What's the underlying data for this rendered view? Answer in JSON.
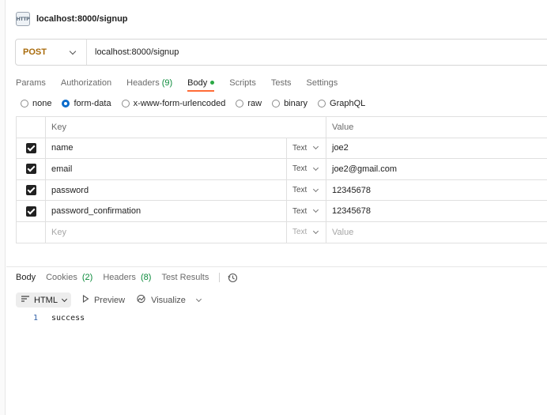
{
  "request": {
    "title": "localhost:8000/signup",
    "method": "POST",
    "url": "localhost:8000/signup"
  },
  "tabs": [
    {
      "label": "Params"
    },
    {
      "label": "Authorization"
    },
    {
      "label": "Headers",
      "count": "(9)"
    },
    {
      "label": "Body"
    },
    {
      "label": "Scripts"
    },
    {
      "label": "Tests"
    },
    {
      "label": "Settings"
    }
  ],
  "body_types": [
    {
      "label": "none"
    },
    {
      "label": "form-data"
    },
    {
      "label": "x-www-form-urlencoded"
    },
    {
      "label": "raw"
    },
    {
      "label": "binary"
    },
    {
      "label": "GraphQL"
    }
  ],
  "table": {
    "header_key": "Key",
    "header_value": "Value",
    "rows": [
      {
        "key": "name",
        "type": "Text",
        "value": "joe2"
      },
      {
        "key": "email",
        "type": "Text",
        "value": "joe2@gmail.com"
      },
      {
        "key": "password",
        "type": "Text",
        "value": "12345678"
      },
      {
        "key": "password_confirmation",
        "type": "Text",
        "value": "12345678"
      }
    ],
    "placeholder": {
      "key": "Key",
      "type": "Text",
      "value": "Value"
    }
  },
  "response": {
    "tabs": [
      {
        "label": "Body"
      },
      {
        "label": "Cookies",
        "count": "(2)"
      },
      {
        "label": "Headers",
        "count": "(8)"
      },
      {
        "label": "Test Results"
      }
    ],
    "format": "HTML",
    "preview_label": "Preview",
    "visualize_label": "Visualize",
    "line_number": "1",
    "content": "success"
  },
  "colors": {
    "method": "#a86a0a",
    "active_tab_underline": "#ff6c37",
    "count_green": "#0a8a3a",
    "radio_selected": "#0b6bcb"
  }
}
